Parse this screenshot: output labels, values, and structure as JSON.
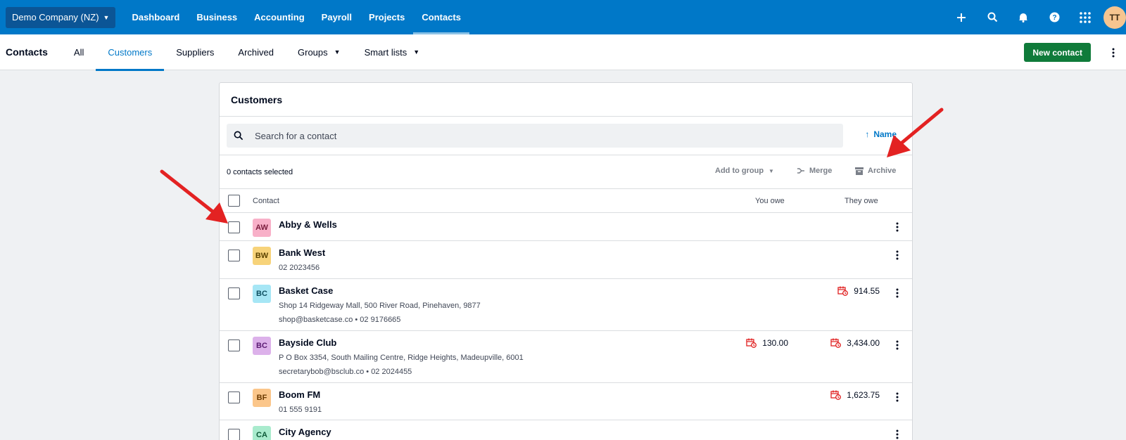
{
  "topbar": {
    "org": "Demo Company (NZ)",
    "nav": [
      "Dashboard",
      "Business",
      "Accounting",
      "Payroll",
      "Projects",
      "Contacts"
    ],
    "active_nav": "Contacts",
    "icons": [
      "plus-icon",
      "search-icon",
      "bell-icon",
      "help-icon",
      "apps-grid-icon"
    ],
    "user_initials": "TT",
    "bg_color": "#0078c8"
  },
  "subnav": {
    "title": "Contacts",
    "tabs": [
      {
        "label": "All",
        "dropdown": false
      },
      {
        "label": "Customers",
        "dropdown": false,
        "active": true
      },
      {
        "label": "Suppliers",
        "dropdown": false
      },
      {
        "label": "Archived",
        "dropdown": false
      },
      {
        "label": "Groups",
        "dropdown": true
      },
      {
        "label": "Smart lists",
        "dropdown": true
      }
    ],
    "new_contact": "New contact"
  },
  "card": {
    "title": "Customers",
    "search_placeholder": "Search for a contact",
    "sort_label": "Name",
    "selected_text": "0 contacts selected",
    "actions": {
      "add_to_group": "Add to group",
      "merge": "Merge",
      "archive": "Archive"
    },
    "columns": {
      "contact": "Contact",
      "you_owe": "You owe",
      "they_owe": "They owe"
    }
  },
  "contacts": [
    {
      "initials": "AW",
      "name": "Abby & Wells",
      "badge_bg": "#f8b0c8",
      "badge_fg": "#7a1d3d",
      "lines": [],
      "you_owe": "",
      "they_owe": ""
    },
    {
      "initials": "BW",
      "name": "Bank West",
      "badge_bg": "#f7d37a",
      "badge_fg": "#5c4300",
      "lines": [
        "02 2023456"
      ],
      "you_owe": "",
      "they_owe": ""
    },
    {
      "initials": "BC",
      "name": "Basket Case",
      "badge_bg": "#a6e6f5",
      "badge_fg": "#0d4f60",
      "lines": [
        "Shop 14 Ridgeway Mall, 500 River Road, Pinehaven, 9877",
        "shop@basketcase.co  •  02 9176665"
      ],
      "you_owe": "",
      "they_owe": "914.55"
    },
    {
      "initials": "BC",
      "name": "Bayside Club",
      "badge_bg": "#dcb1ea",
      "badge_fg": "#5a1a72",
      "lines": [
        "P O Box 3354, South Mailing Centre, Ridge Heights, Madeupville, 6001",
        "secretarybob@bsclub.co  •  02 2024455"
      ],
      "you_owe": "130.00",
      "they_owe": "3,434.00"
    },
    {
      "initials": "BF",
      "name": "Boom FM",
      "badge_bg": "#fbc68a",
      "badge_fg": "#6b3a00",
      "lines": [
        "01 555 9191"
      ],
      "you_owe": "",
      "they_owe": "1,623.75"
    },
    {
      "initials": "CA",
      "name": "City Agency",
      "badge_bg": "#a9ebcd",
      "badge_fg": "#0e5a38",
      "lines": [],
      "you_owe": "",
      "they_owe": ""
    }
  ],
  "annotation_color": "#e32222"
}
